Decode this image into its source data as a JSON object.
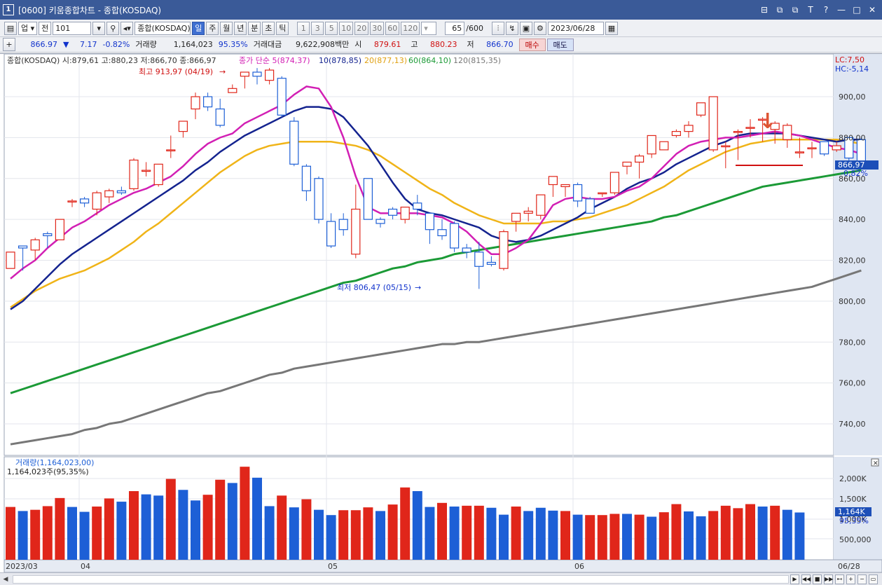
{
  "window": {
    "num": "1",
    "title": "[0600] 키움종합차트 - 종합(KOSDAQ)",
    "controls": [
      "⊟",
      "⧉",
      "⧉",
      "T",
      "?",
      "—",
      "□",
      "✕"
    ]
  },
  "toolbar": {
    "market": "업",
    "all": "전",
    "code": "101",
    "name": "종합(KOSDAQ)",
    "periods": [
      "일",
      "주",
      "월",
      "년",
      "분",
      "초",
      "틱"
    ],
    "active_period": "일",
    "minute_steps": [
      "1",
      "3",
      "5",
      "10",
      "20",
      "30",
      "60",
      "120"
    ],
    "count": "65",
    "count_max": "/600",
    "date": "2023/06/28"
  },
  "pricebar": {
    "price": "866.97",
    "arrow": "▼",
    "change": "7.17",
    "change_pct": "-0.82%",
    "volume_label": "거래량",
    "volume": "1,164,023",
    "volume_pct": "95.35%",
    "amount_label": "거래대금",
    "amount": "9,622,908백만",
    "open_label": "시",
    "open": "879.61",
    "high_label": "고",
    "high": "880.23",
    "low_label": "저",
    "low": "866.70",
    "buy": "매수",
    "sell": "매도"
  },
  "chart_header": {
    "ohlc_text": "종합(KOSDAQ) 시:879,61 고:880,23 저:866,70 종:866,97",
    "ma5": "종가 단순 5(874,37)",
    "ma10": "10(878,85)",
    "ma20": "20(877,13)",
    "ma60": "60(864,10)",
    "ma120": "120(815,35)",
    "lc": "LC:7,50",
    "hc": "HC:-5,14",
    "high_annot": "최고 913,97 (04/19)",
    "low_annot": "최저 806,47 (05/15)",
    "current_tag": "866,97",
    "current_pct": "-0,82%",
    "volume_title": "거래량(1,164,023,00)",
    "volume_sub": "1,164,023주(95,35%)",
    "volume_tag": "1,164K",
    "volume_pct": "95,35%"
  },
  "colors": {
    "up": "#e0261a",
    "down": "#1d5fd6",
    "ma5": "#d21fb4",
    "ma10": "#14238f",
    "ma20": "#f0b418",
    "ma60": "#1b9a36",
    "ma120": "#777777"
  },
  "chart_data": {
    "type": "candlestick",
    "price_axis": [
      900,
      880,
      860,
      840,
      820,
      800,
      780,
      760,
      740
    ],
    "price_axis_labels": [
      "900,00",
      "880,00",
      "860,00",
      "840,00",
      "820,00",
      "800,00",
      "780,00",
      "760,00",
      "740,00"
    ],
    "volume_axis_labels": [
      "2,000K",
      "1,500K",
      "1,000K",
      "500,000"
    ],
    "x_labels": [
      "2023/03",
      "04",
      "05",
      "06",
      "06/28"
    ],
    "candles": [
      [
        816,
        824,
        816,
        824
      ],
      [
        827,
        827,
        815,
        826
      ],
      [
        825,
        831,
        820,
        830
      ],
      [
        833,
        834,
        826,
        832
      ],
      [
        830,
        840,
        830,
        840
      ],
      [
        849,
        850,
        846,
        849
      ],
      [
        850,
        851,
        846,
        848
      ],
      [
        845,
        854,
        842,
        853
      ],
      [
        851,
        855,
        848,
        854
      ],
      [
        854,
        856,
        852,
        853
      ],
      [
        855,
        870,
        854,
        869
      ],
      [
        864,
        868,
        861,
        864
      ],
      [
        857,
        867,
        856,
        867
      ],
      [
        874,
        881,
        870,
        874
      ],
      [
        883,
        888,
        880,
        888
      ],
      [
        894,
        902,
        889,
        900
      ],
      [
        900,
        902,
        893,
        895
      ],
      [
        894,
        899,
        885,
        886
      ],
      [
        902,
        906,
        902,
        904
      ],
      [
        910,
        912,
        904,
        912
      ],
      [
        912,
        914,
        906,
        910
      ],
      [
        908,
        914,
        906,
        913
      ],
      [
        909,
        910,
        890,
        891
      ],
      [
        888,
        890,
        866,
        867
      ],
      [
        866,
        867,
        849,
        854
      ],
      [
        860,
        861,
        838,
        840
      ],
      [
        839,
        843,
        826,
        827
      ],
      [
        840,
        843,
        832,
        835
      ],
      [
        823,
        857,
        821,
        845
      ],
      [
        860,
        860,
        840,
        840
      ],
      [
        840,
        841,
        836,
        838
      ],
      [
        845,
        846,
        840,
        842
      ],
      [
        840,
        846,
        838,
        846
      ],
      [
        848,
        852,
        842,
        845
      ],
      [
        843,
        843,
        828,
        835
      ],
      [
        835,
        840,
        830,
        832
      ],
      [
        838,
        839,
        824,
        826
      ],
      [
        826,
        828,
        821,
        824
      ],
      [
        824,
        829,
        806,
        817
      ],
      [
        819,
        822,
        817,
        818
      ],
      [
        816,
        835,
        815,
        834
      ],
      [
        839,
        843,
        834,
        843
      ],
      [
        843,
        846,
        839,
        844
      ],
      [
        842,
        852,
        840,
        852
      ],
      [
        857,
        861,
        851,
        861
      ],
      [
        856,
        857,
        851,
        857
      ],
      [
        857,
        858,
        846,
        849
      ],
      [
        850,
        851,
        843,
        843
      ],
      [
        853,
        853,
        851,
        853
      ],
      [
        853,
        863,
        852,
        863
      ],
      [
        866,
        868,
        862,
        868
      ],
      [
        868,
        872,
        860,
        871
      ],
      [
        872,
        881,
        870,
        881
      ],
      [
        874,
        878,
        874,
        878
      ],
      [
        881,
        884,
        880,
        883
      ],
      [
        883,
        888,
        880,
        886
      ],
      [
        891,
        897,
        890,
        897
      ],
      [
        874,
        900,
        873,
        900
      ],
      [
        876,
        878,
        865,
        876
      ],
      [
        883,
        884,
        869,
        883
      ],
      [
        885,
        889,
        880,
        885
      ],
      [
        889,
        890,
        878,
        889
      ],
      [
        884,
        888,
        877,
        887
      ],
      [
        879,
        887,
        875,
        886
      ],
      [
        873,
        880,
        870,
        873
      ],
      [
        875,
        878,
        870,
        875
      ],
      [
        878,
        878,
        871,
        872
      ],
      [
        874,
        878,
        873,
        876
      ],
      [
        880,
        880,
        868,
        870
      ],
      [
        879,
        880,
        866,
        866
      ]
    ],
    "ma5": [
      811,
      816,
      820,
      826,
      831,
      836,
      839,
      843,
      847,
      850,
      853,
      855,
      858,
      861,
      866,
      872,
      877,
      880,
      882,
      887,
      890,
      893,
      896,
      901,
      905,
      904,
      895,
      880,
      861,
      846,
      843,
      843,
      843,
      843,
      842,
      841,
      838,
      834,
      828,
      823,
      823,
      826,
      830,
      838,
      847,
      850,
      851,
      850,
      850,
      851,
      854,
      856,
      860,
      866,
      872,
      876,
      878,
      879,
      880,
      880,
      881,
      882,
      883,
      882,
      881,
      879,
      877,
      875,
      874,
      872
    ],
    "ma10": [
      796,
      800,
      806,
      812,
      818,
      823,
      827,
      831,
      835,
      839,
      843,
      847,
      851,
      855,
      859,
      864,
      868,
      873,
      877,
      881,
      884,
      887,
      890,
      893,
      895,
      895,
      894,
      890,
      883,
      876,
      867,
      858,
      850,
      845,
      843,
      842,
      840,
      838,
      836,
      832,
      830,
      829,
      830,
      832,
      835,
      838,
      841,
      845,
      848,
      851,
      855,
      858,
      860,
      863,
      867,
      870,
      873,
      876,
      878,
      881,
      882,
      882,
      882,
      882,
      881,
      880,
      879,
      878,
      879,
      879
    ],
    "ma20": [
      797,
      801,
      805,
      808,
      811,
      813,
      815,
      818,
      821,
      825,
      829,
      834,
      838,
      843,
      848,
      853,
      858,
      863,
      867,
      871,
      874,
      876,
      877,
      878,
      878,
      878,
      878,
      877,
      876,
      874,
      871,
      867,
      863,
      859,
      855,
      852,
      848,
      845,
      842,
      840,
      838,
      838,
      838,
      838,
      839,
      839,
      840,
      841,
      843,
      845,
      847,
      850,
      853,
      856,
      860,
      864,
      867,
      870,
      873,
      875,
      877,
      878,
      879,
      879,
      879,
      879,
      879,
      879,
      878,
      877
    ],
    "ma60": [
      755,
      757,
      759,
      761,
      763,
      765,
      767,
      769,
      771,
      773,
      775,
      777,
      779,
      781,
      783,
      785,
      787,
      789,
      791,
      793,
      795,
      797,
      799,
      801,
      803,
      805,
      807,
      809,
      810,
      812,
      814,
      816,
      817,
      819,
      820,
      821,
      823,
      824,
      825,
      826,
      827,
      828,
      829,
      830,
      831,
      832,
      833,
      834,
      835,
      836,
      837,
      838,
      839,
      841,
      842,
      844,
      846,
      848,
      850,
      852,
      854,
      856,
      857,
      858,
      859,
      860,
      861,
      862,
      863,
      864
    ],
    "ma120": [
      730,
      731,
      732,
      733,
      734,
      735,
      737,
      738,
      740,
      741,
      743,
      745,
      747,
      749,
      751,
      753,
      755,
      756,
      758,
      760,
      762,
      764,
      765,
      767,
      768,
      769,
      770,
      771,
      772,
      773,
      774,
      775,
      776,
      777,
      778,
      779,
      779,
      780,
      780,
      781,
      782,
      783,
      784,
      785,
      786,
      787,
      788,
      789,
      790,
      791,
      792,
      793,
      794,
      795,
      796,
      797,
      798,
      799,
      800,
      801,
      802,
      803,
      804,
      805,
      806,
      807,
      809,
      811,
      813,
      815
    ],
    "volume_bars": [
      {
        "v": 1300,
        "up": true
      },
      {
        "v": 1200,
        "up": false
      },
      {
        "v": 1230,
        "up": true
      },
      {
        "v": 1320,
        "up": true
      },
      {
        "v": 1520,
        "up": true
      },
      {
        "v": 1300,
        "up": false
      },
      {
        "v": 1180,
        "up": false
      },
      {
        "v": 1310,
        "up": true
      },
      {
        "v": 1510,
        "up": true
      },
      {
        "v": 1430,
        "up": false
      },
      {
        "v": 1690,
        "up": true
      },
      {
        "v": 1610,
        "up": false
      },
      {
        "v": 1580,
        "up": false
      },
      {
        "v": 1990,
        "up": true
      },
      {
        "v": 1720,
        "up": false
      },
      {
        "v": 1460,
        "up": false
      },
      {
        "v": 1600,
        "up": true
      },
      {
        "v": 1970,
        "up": true
      },
      {
        "v": 1890,
        "up": false
      },
      {
        "v": 2290,
        "up": true
      },
      {
        "v": 2020,
        "up": false
      },
      {
        "v": 1320,
        "up": false
      },
      {
        "v": 1580,
        "up": true
      },
      {
        "v": 1290,
        "up": false
      },
      {
        "v": 1490,
        "up": true
      },
      {
        "v": 1230,
        "up": false
      },
      {
        "v": 1100,
        "up": false
      },
      {
        "v": 1220,
        "up": true
      },
      {
        "v": 1220,
        "up": true
      },
      {
        "v": 1290,
        "up": true
      },
      {
        "v": 1200,
        "up": false
      },
      {
        "v": 1360,
        "up": true
      },
      {
        "v": 1780,
        "up": true
      },
      {
        "v": 1690,
        "up": false
      },
      {
        "v": 1300,
        "up": false
      },
      {
        "v": 1400,
        "up": true
      },
      {
        "v": 1310,
        "up": false
      },
      {
        "v": 1330,
        "up": true
      },
      {
        "v": 1330,
        "up": true
      },
      {
        "v": 1280,
        "up": false
      },
      {
        "v": 1110,
        "up": false
      },
      {
        "v": 1310,
        "up": true
      },
      {
        "v": 1200,
        "up": false
      },
      {
        "v": 1280,
        "up": false
      },
      {
        "v": 1210,
        "up": false
      },
      {
        "v": 1200,
        "up": true
      },
      {
        "v": 1110,
        "up": false
      },
      {
        "v": 1100,
        "up": true
      },
      {
        "v": 1100,
        "up": true
      },
      {
        "v": 1130,
        "up": true
      },
      {
        "v": 1130,
        "up": false
      },
      {
        "v": 1110,
        "up": true
      },
      {
        "v": 1060,
        "up": false
      },
      {
        "v": 1170,
        "up": true
      },
      {
        "v": 1370,
        "up": true
      },
      {
        "v": 1190,
        "up": false
      },
      {
        "v": 1070,
        "up": false
      },
      {
        "v": 1200,
        "up": true
      },
      {
        "v": 1330,
        "up": true
      },
      {
        "v": 1270,
        "up": true
      },
      {
        "v": 1370,
        "up": true
      },
      {
        "v": 1310,
        "up": false
      },
      {
        "v": 1330,
        "up": true
      },
      {
        "v": 1230,
        "up": false
      },
      {
        "v": 1164,
        "up": false
      }
    ],
    "arrow_mark": "↓"
  }
}
